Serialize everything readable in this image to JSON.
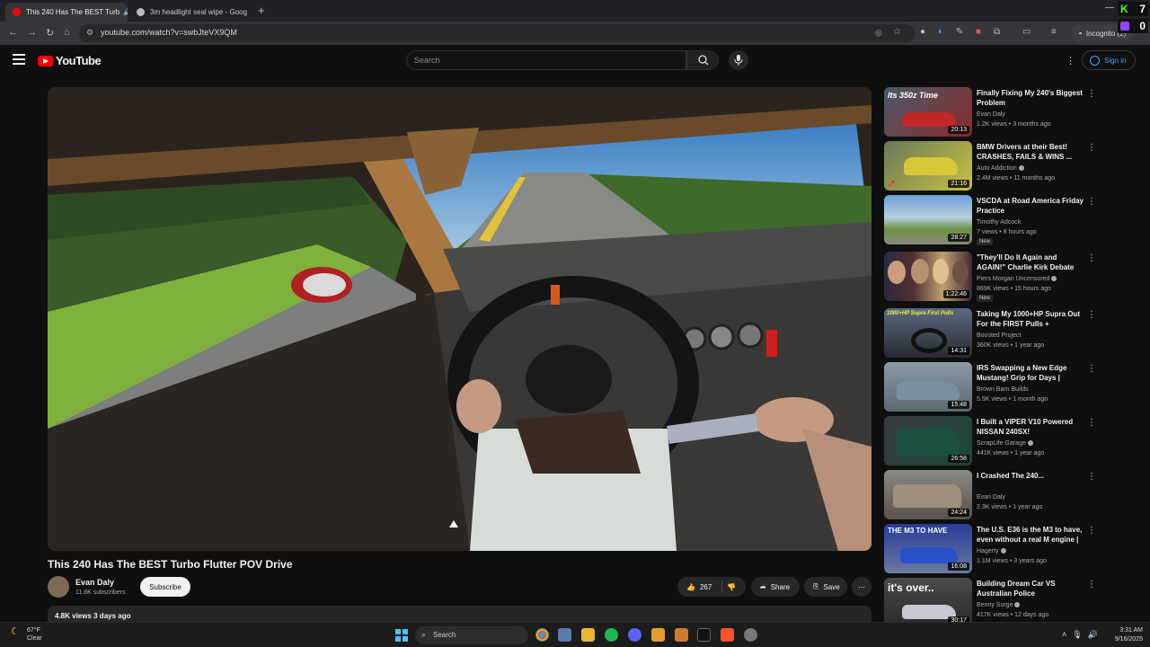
{
  "browser": {
    "tabs": [
      {
        "title": "This 240 Has The BEST Turb",
        "active": true
      },
      {
        "title": "3m headlight seal wipe - Goog",
        "active": false
      }
    ],
    "url": "youtube.com/watch?v=swbJteVX9QM",
    "incognito_label": "Incognito (2)"
  },
  "overlay": {
    "k_label": "K",
    "k_count": "7",
    "t_count": "0"
  },
  "masthead": {
    "logo_text": "YouTube",
    "search_placeholder": "Search",
    "signin_label": "Sign in"
  },
  "video": {
    "title": "This 240 Has The BEST Turbo Flutter POV Drive",
    "channel": "Evan Daly",
    "subscribers": "11.8K subscribers",
    "subscribe_label": "Subscribe",
    "likes": "267",
    "share_label": "Share",
    "save_label": "Save",
    "views_date": "4.8K views  3 days ago"
  },
  "recommendations": [
    {
      "title": "Finally Fixing My 240's Biggest Problem",
      "channel": "Evan Daly",
      "verified": false,
      "meta": "1.2K views • 3 months ago",
      "duration": "20:13",
      "badge": "",
      "thumb": "#5a2a2a"
    },
    {
      "title": "BMW Drivers at their Best! CRASHES, FAILS & WINS ...",
      "channel": "Auto Addiction",
      "verified": true,
      "meta": "2.4M views • 11 months ago",
      "duration": "21:16",
      "badge": "",
      "thumb": "#8a9a3a"
    },
    {
      "title": "VSCDA at Road America Friday Practice",
      "channel": "Timothy Adcock",
      "verified": false,
      "meta": "7 views • 8 hours ago",
      "duration": "28:27",
      "badge": "New",
      "thumb": "#6a8aa8"
    },
    {
      "title": "\"They'll Do It Again and AGAIN!\" Charlie Kirk Debate Causes ...",
      "channel": "Piers Morgan Uncensored",
      "verified": true,
      "meta": "869K views • 15 hours ago",
      "duration": "1:22:46",
      "badge": "New",
      "thumb": "#3a3040"
    },
    {
      "title": "Taking My 1000+HP Supra Out For the FIRST Pulls + Recording...",
      "channel": "Boosted Project",
      "verified": false,
      "meta": "360K views • 1 year ago",
      "duration": "14:31",
      "badge": "",
      "thumb": "#4a5060"
    },
    {
      "title": "IRS Swapping a New Edge Mustang! Grip for Days | Brow...",
      "channel": "Brown Barn Builds",
      "verified": false,
      "meta": "5.5K views • 1 month ago",
      "duration": "15:48",
      "badge": "",
      "thumb": "#6a7a80"
    },
    {
      "title": "I Built a VIPER V10 Powered NISSAN 240SX!",
      "channel": "ScrapLife Garage",
      "verified": true,
      "meta": "441K views • 1 year ago",
      "duration": "26:58",
      "badge": "",
      "thumb": "#2a4a3a"
    },
    {
      "title": "I Crashed The 240...",
      "channel": "Evan Daly",
      "verified": false,
      "meta": "2.3K views • 1 year ago",
      "duration": "24:24",
      "badge": "",
      "thumb": "#7a6a5a"
    },
    {
      "title": "The U.S. E36 is the M3 to have, even without a real M engine | ...",
      "channel": "Hagerty",
      "verified": true,
      "meta": "1.1M views • 3 years ago",
      "duration": "16:08",
      "badge": "",
      "thumb": "#2a3a8a"
    },
    {
      "title": "Building Dream Car VS Australian Police",
      "channel": "Benny Surge",
      "verified": true,
      "meta": "417K views • 12 days ago",
      "duration": "30:17",
      "badge": "",
      "thumb": "#3a3a3a"
    }
  ],
  "thumb_overlays": {
    "rec0": "Its 350z Time",
    "rec4": "1000+HP Supra First Pulls",
    "rec8": "THE M3 TO HAVE",
    "rec9": "it's over.."
  },
  "taskbar": {
    "weather_temp": "67°F",
    "weather_desc": "Clear",
    "search_label": "Search",
    "time": "3:31 AM",
    "date": "9/16/2025"
  }
}
